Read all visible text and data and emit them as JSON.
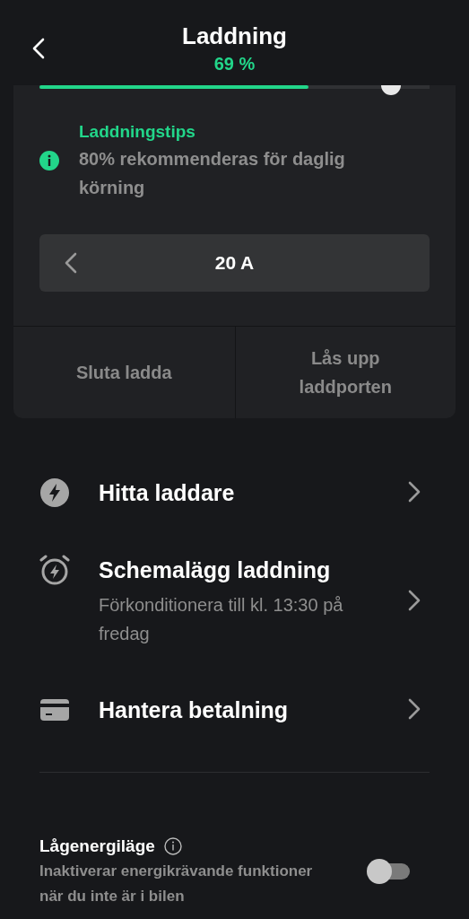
{
  "header": {
    "title": "Laddning",
    "charge": "69 %"
  },
  "charge_slider": {
    "fill": {
      "level": 0.69
    },
    "limit": {
      "level": 0.9
    }
  },
  "tip": {
    "title": "Laddningstips",
    "text": "80% rekommenderas för daglig körning"
  },
  "current": {
    "value": "20 A"
  },
  "actions": [
    {
      "label": "Sluta ladda"
    },
    {
      "label": "Lås upp laddporten"
    }
  ],
  "menu": [
    {
      "kind": "bolt",
      "title": "Hitta laddare"
    },
    {
      "kind": "alarm",
      "title": "Schemalägg laddning",
      "subtitle": "Förkonditionera till kl. 13:30 på fredag"
    },
    {
      "kind": "card",
      "title": "Hantera betalning"
    }
  ],
  "low_energy": {
    "title": "Lågenergiläge",
    "text": "Inaktiverar energikrävande funktioner när du inte är i bilen",
    "on": false
  }
}
